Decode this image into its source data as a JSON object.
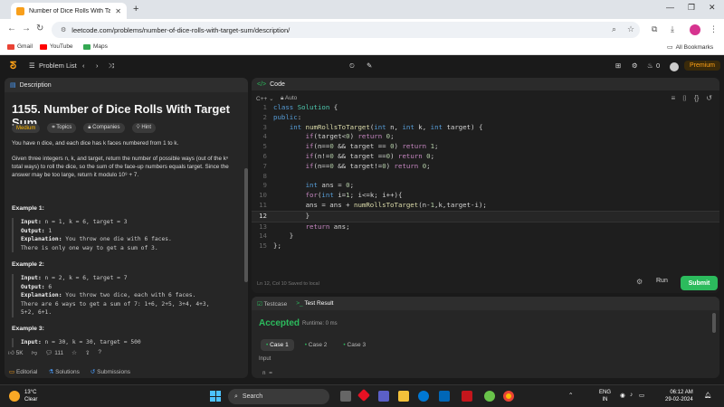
{
  "browser": {
    "tab_title": "Number of Dice Rolls With Targ",
    "url": "leetcode.com/problems/number-of-dice-rolls-with-target-sum/description/",
    "bookmarks": [
      "Gmail",
      "YouTube",
      "Maps"
    ],
    "all_bookmarks": "All Bookmarks"
  },
  "lc_nav": {
    "problem_list": "Problem List",
    "streak": "0",
    "premium": "Premium"
  },
  "description_panel": {
    "tab": "Description",
    "title": "1155. Number of Dice Rolls With Target Sum",
    "difficulty": "Medium",
    "tags": [
      "Topics",
      "Companies",
      "Hint"
    ],
    "para1": "You have n dice, and each dice has k faces numbered from 1 to k.",
    "para2": "Given three integers n, k, and target, return the number of possible ways (out of the kⁿ total ways) to roll the dice, so the sum of the face-up numbers equals target. Since the answer may be too large, return it modulo 10⁹ + 7.",
    "examples": [
      {
        "heading": "Example 1:",
        "input": "n = 1, k = 6, target = 3",
        "output": "1",
        "explanation": "You throw one die with 6 faces.",
        "explanation2": "There is only one way to get a sum of 3."
      },
      {
        "heading": "Example 2:",
        "input": "n = 2, k = 6, target = 7",
        "output": "6",
        "explanation": "You throw two dice, each with 6 faces.",
        "explanation2": "There are 6 ways to get a sum of 7: 1+6, 2+5, 3+4, 4+3,",
        "explanation3": "5+2, 6+1."
      },
      {
        "heading": "Example 3:",
        "input": "n = 30, k = 30, target = 500"
      }
    ],
    "likes": "5K",
    "comments": "111",
    "bottom_tabs": [
      "Editorial",
      "Solutions",
      "Submissions"
    ]
  },
  "code_panel": {
    "tab": "Code",
    "language": "C++",
    "mode": "Auto",
    "lines": [
      "class Solution {",
      "public:",
      "    int numRollsToTarget(int n, int k, int target) {",
      "        if(target<0) return 0;",
      "        if(n==0 && target == 0) return 1;",
      "        if(n!=0 && target ==0) return 0;",
      "        if(n==0 && target!=0) return 0;",
      "",
      "        int ans = 0;",
      "        for(int i=1; i<=k; i++){",
      "        ans = ans + numRollsToTarget(n-1,k,target-i);",
      "        }",
      "        return ans;",
      "    }",
      "};"
    ],
    "status": "Ln 12, Col 10     Saved to local",
    "run": "Run",
    "submit": "Submit"
  },
  "test_panel": {
    "testcase_tab": "Testcase",
    "result_tab": "Test Result",
    "verdict": "Accepted",
    "runtime": "Runtime: 0 ms",
    "cases": [
      "Case 1",
      "Case 2",
      "Case 3"
    ],
    "input_label": "Input",
    "input_value": "n ="
  },
  "taskbar": {
    "temp": "13°C",
    "weather": "Clear",
    "search": "Search",
    "lang": "ENG",
    "region": "IN",
    "time": "06:12 AM",
    "date": "29-02-2024"
  }
}
